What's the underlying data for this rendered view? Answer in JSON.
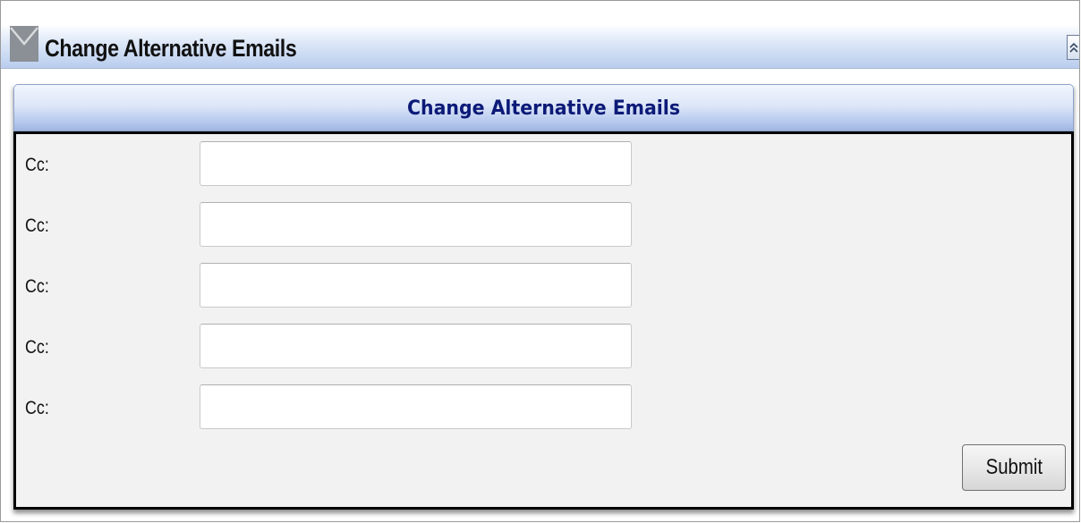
{
  "window": {
    "title": "Change Alternative Emails",
    "title_icon": "envelope-icon",
    "collapse_icon": "double-chevron-up-icon"
  },
  "panel": {
    "header": "Change Alternative Emails"
  },
  "form": {
    "fields": [
      {
        "label": "Cc:",
        "value": ""
      },
      {
        "label": "Cc:",
        "value": ""
      },
      {
        "label": "Cc:",
        "value": ""
      },
      {
        "label": "Cc:",
        "value": ""
      },
      {
        "label": "Cc:",
        "value": ""
      }
    ],
    "submit_label": "Submit"
  },
  "colors": {
    "panel_header_text": "#0c1a78",
    "form_background": "#f2f2f2",
    "form_border": "#000000"
  }
}
